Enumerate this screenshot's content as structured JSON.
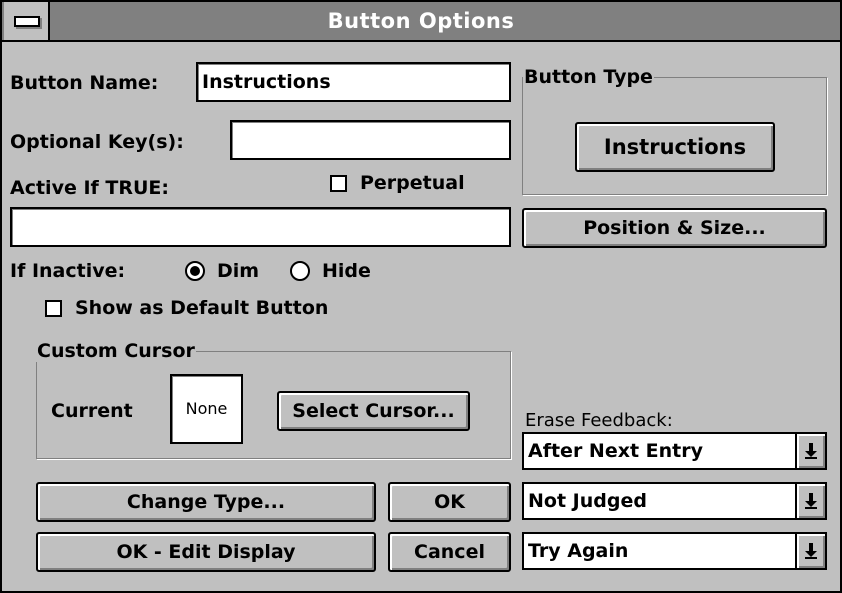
{
  "window": {
    "title": "Button Options"
  },
  "fields": {
    "button_name_label": "Button Name:",
    "button_name_value": "Instructions",
    "optional_keys_label": "Optional Key(s):",
    "optional_keys_value": "",
    "active_if_label": "Active If TRUE:",
    "active_if_value": "",
    "perpetual_label": "Perpetual",
    "perpetual_checked": false
  },
  "inactive": {
    "label": "If Inactive:",
    "options": [
      {
        "label": "Dim",
        "selected": true
      },
      {
        "label": "Hide",
        "selected": false
      }
    ]
  },
  "show_default": {
    "label": "Show as Default Button",
    "checked": false
  },
  "custom_cursor": {
    "group_label": "Custom Cursor",
    "current_label": "Current",
    "current_value": "None",
    "select_button": "Select Cursor..."
  },
  "button_type": {
    "group_label": "Button Type",
    "preview_label": "Instructions",
    "position_size_button": "Position & Size..."
  },
  "erase_feedback": {
    "label": "Erase Feedback:",
    "selects": [
      "After Next Entry",
      "Not Judged",
      "Try Again"
    ]
  },
  "actions": {
    "change_type": "Change Type...",
    "ok": "OK",
    "ok_edit_display": "OK - Edit Display",
    "cancel": "Cancel"
  }
}
